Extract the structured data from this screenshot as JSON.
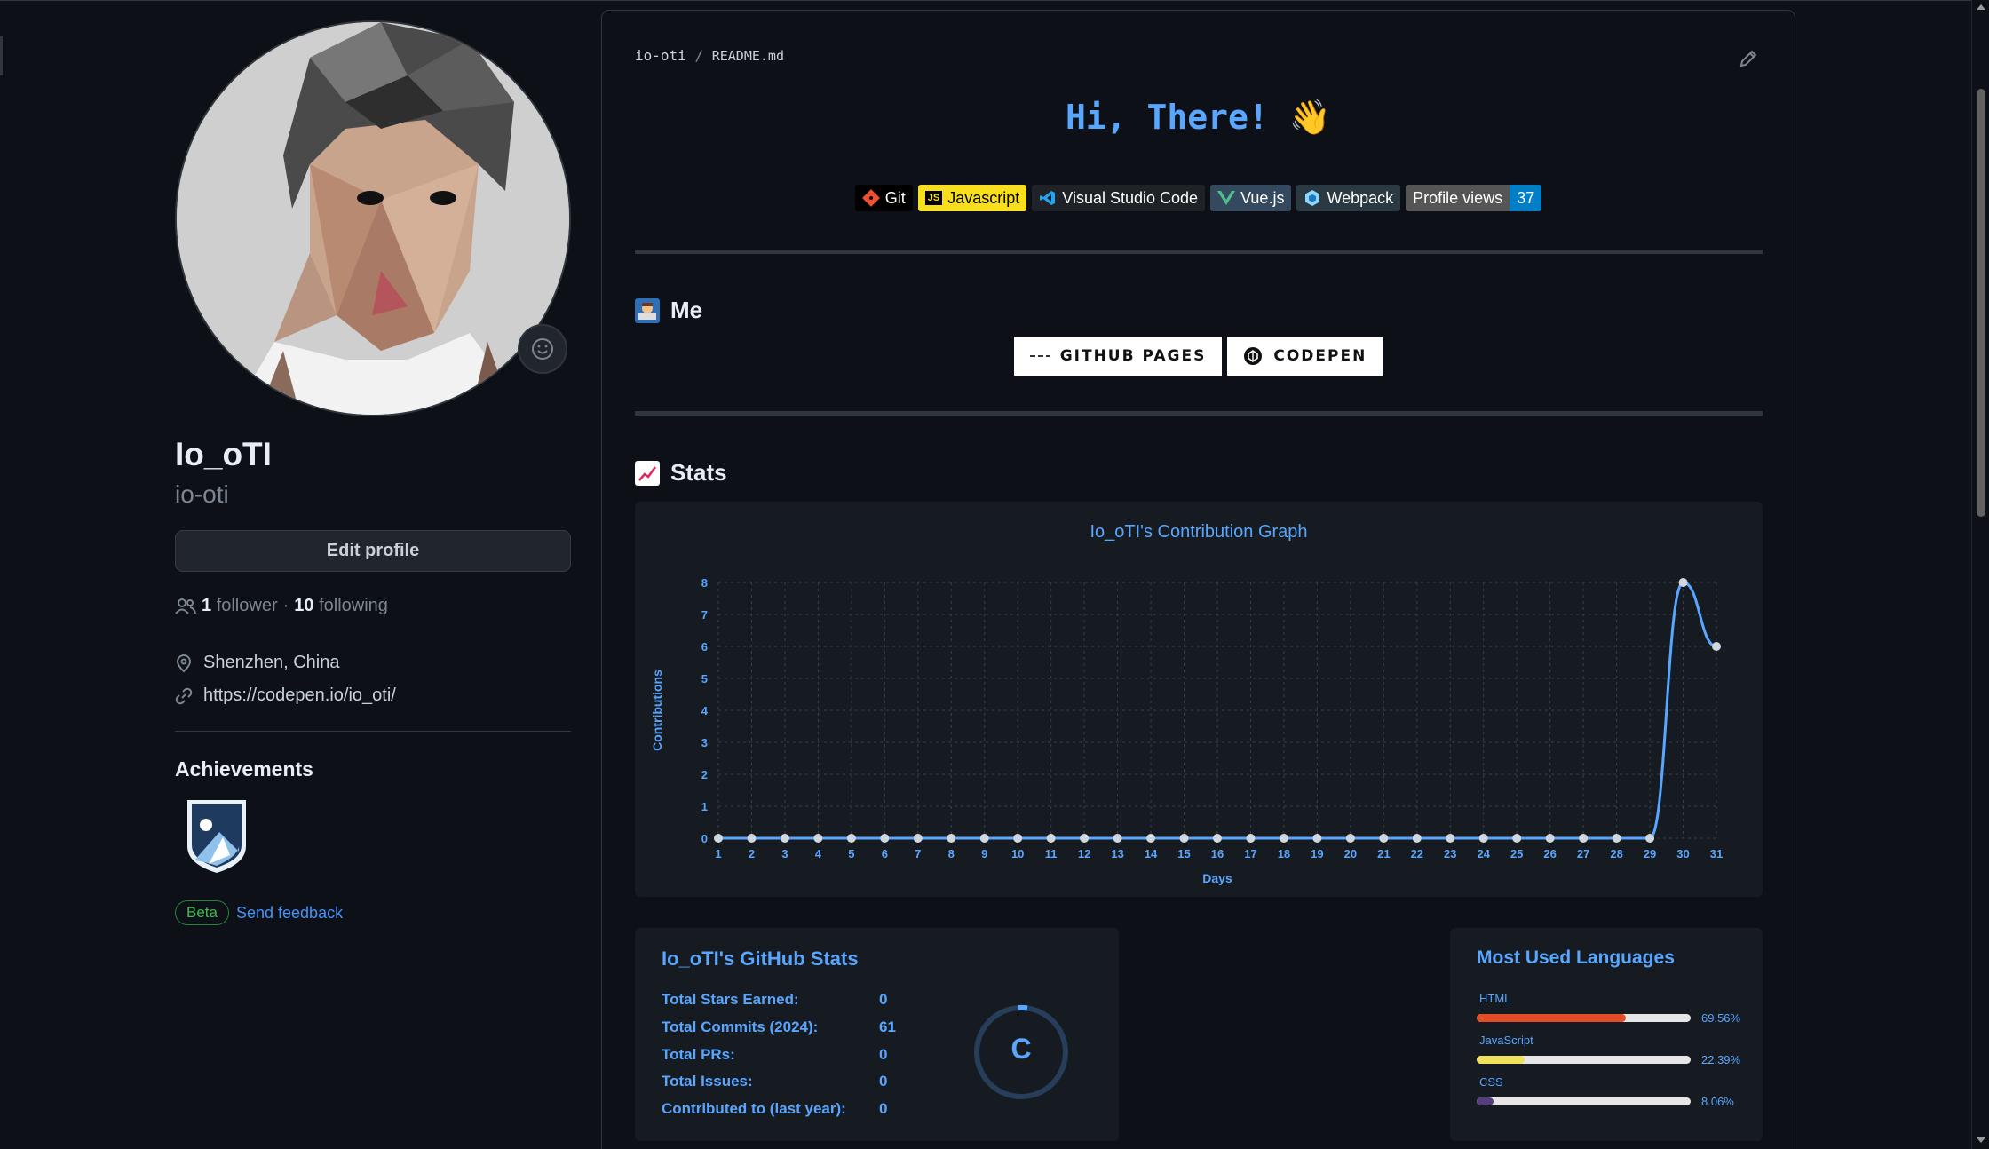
{
  "profile": {
    "name": "Io_oTI",
    "login": "io-oti",
    "edit_label": "Edit profile",
    "followers_count": "1",
    "followers_label": "follower",
    "sep": "·",
    "following_count": "10",
    "following_label": "following",
    "location": "Shenzhen, China",
    "website": "https://codepen.io/io_oti/"
  },
  "achievements": {
    "title": "Achievements",
    "beta": "Beta",
    "feedback": "Send feedback"
  },
  "readme": {
    "crumb_user": "io-oti",
    "crumb_sep": "/",
    "crumb_file": "README.md",
    "hi": "Hi, There! 👋",
    "badges": [
      {
        "label": "Git"
      },
      {
        "icon": "JS",
        "label": "Javascript"
      },
      {
        "label": "Visual Studio Code"
      },
      {
        "label": "Vue.js"
      },
      {
        "label": "Webpack"
      }
    ],
    "profile_views_label": "Profile views",
    "profile_views_count": "37",
    "me_title": "Me",
    "github_pages": "GITHUB PAGES",
    "codepen": "CODEPEN",
    "stats_title": "Stats"
  },
  "chart_data": {
    "type": "line",
    "title": "Io_oTI's Contribution Graph",
    "xlabel": "Days",
    "ylabel": "Contributions",
    "x": [
      1,
      2,
      3,
      4,
      5,
      6,
      7,
      8,
      9,
      10,
      11,
      12,
      13,
      14,
      15,
      16,
      17,
      18,
      19,
      20,
      21,
      22,
      23,
      24,
      25,
      26,
      27,
      28,
      29,
      30,
      31
    ],
    "values": [
      0,
      0,
      0,
      0,
      0,
      0,
      0,
      0,
      0,
      0,
      0,
      0,
      0,
      0,
      0,
      0,
      0,
      0,
      0,
      0,
      0,
      0,
      0,
      0,
      0,
      0,
      0,
      0,
      0,
      8,
      6
    ],
    "yticks": [
      0,
      1,
      2,
      3,
      4,
      5,
      6,
      7,
      8
    ],
    "ylim": [
      0,
      8
    ],
    "grid": true,
    "color": "#58a6ff"
  },
  "github_stats": {
    "title": "Io_oTI's GitHub Stats",
    "rows": [
      {
        "label": "Total Stars Earned:",
        "value": "0"
      },
      {
        "label": "Total Commits (2024):",
        "value": "61"
      },
      {
        "label": "Total PRs:",
        "value": "0"
      },
      {
        "label": "Total Issues:",
        "value": "0"
      },
      {
        "label": "Contributed to (last year):",
        "value": "0"
      }
    ],
    "rank": "C"
  },
  "languages": {
    "title": "Most Used Languages",
    "items": [
      {
        "name": "HTML",
        "percent": 69.56,
        "pct_label": "69.56%",
        "color": "#e34c26"
      },
      {
        "name": "JavaScript",
        "percent": 22.39,
        "pct_label": "22.39%",
        "color": "#f1e05a"
      },
      {
        "name": "CSS",
        "percent": 8.06,
        "pct_label": "8.06%",
        "color": "#563d7c"
      }
    ]
  }
}
